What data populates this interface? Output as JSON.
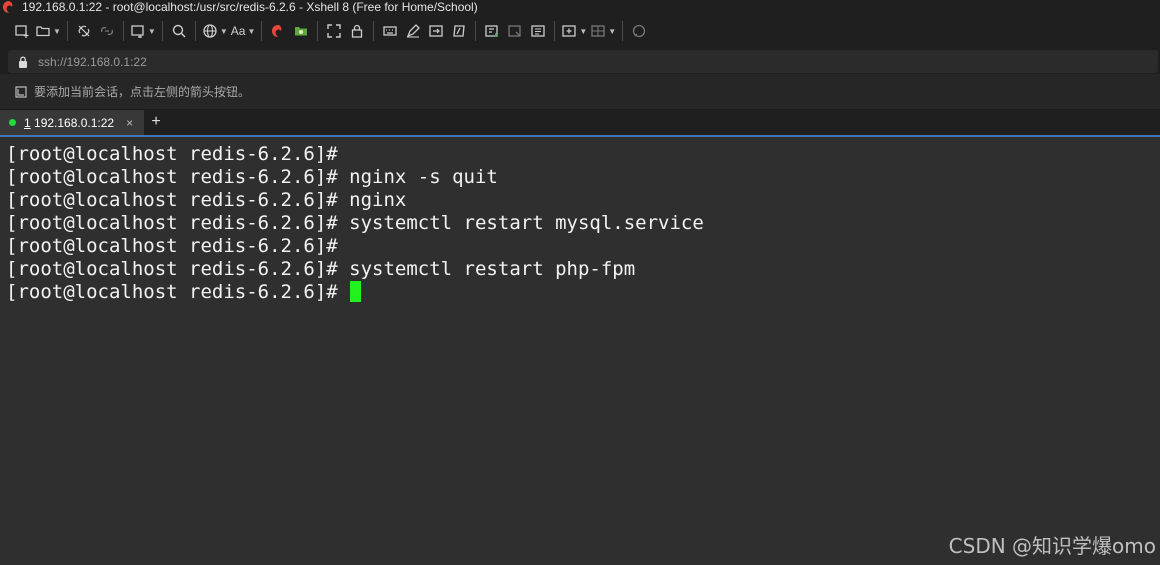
{
  "window": {
    "title": "192.168.0.1:22 - root@localhost:/usr/src/redis-6.2.6 - Xshell 8 (Free for Home/School)"
  },
  "toolbar": {
    "font_label": "Aa"
  },
  "address": {
    "text": "ssh://192.168.0.1:22"
  },
  "session_hint": {
    "text": "要添加当前会话，点击左侧的箭头按钮。"
  },
  "tabs": [
    {
      "number": "1",
      "label": " 192.168.0.1:22",
      "close": "×",
      "status_color": "#1fdc3c"
    }
  ],
  "tab_add_label": "+",
  "terminal": {
    "lines": [
      "[root@localhost redis-6.2.6]#",
      "[root@localhost redis-6.2.6]# nginx -s quit",
      "[root@localhost redis-6.2.6]# nginx",
      "[root@localhost redis-6.2.6]# systemctl restart mysql.service",
      "[root@localhost redis-6.2.6]#",
      "[root@localhost redis-6.2.6]# systemctl restart php-fpm",
      "[root@localhost redis-6.2.6]#"
    ],
    "cursor_color": "#21f21f"
  },
  "watermark": "CSDN @知识学爆omo",
  "colors": {
    "accent": "#3a78b8",
    "background": "#2f2f2f"
  }
}
